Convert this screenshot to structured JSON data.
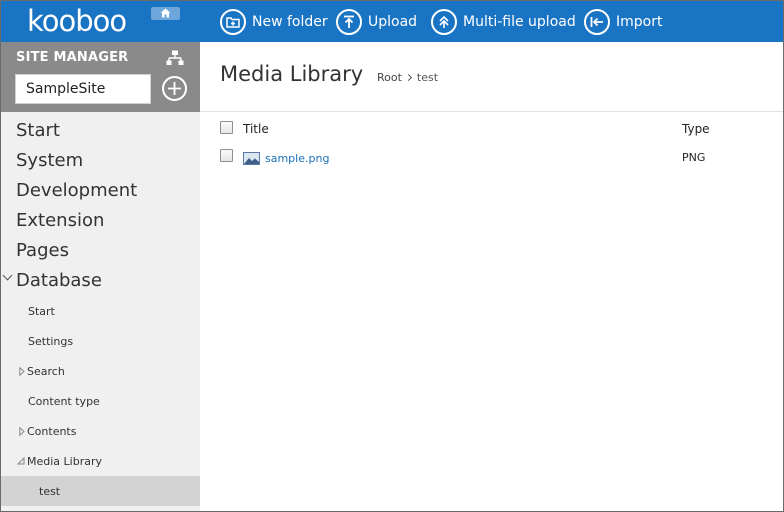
{
  "app": {
    "logo_text": "kooboo"
  },
  "toolbar": {
    "buttons": [
      {
        "label": "New folder",
        "icon": "new-folder-icon"
      },
      {
        "label": "Upload",
        "icon": "upload-icon"
      },
      {
        "label": "Multi-file upload",
        "icon": "multi-upload-icon"
      },
      {
        "label": "Import",
        "icon": "import-icon"
      }
    ]
  },
  "sidebar": {
    "title": "SITE MANAGER",
    "site_name": "SampleSite",
    "top_items": [
      "Start",
      "System",
      "Development",
      "Extension",
      "Pages",
      "Database"
    ],
    "sub_items": [
      "Start",
      "Settings",
      "Search",
      "Content type",
      "Contents",
      "Media Library",
      "test"
    ],
    "active_item": "test"
  },
  "main": {
    "title": "Media Library",
    "breadcrumb": [
      "Root",
      "test"
    ],
    "columns": {
      "title": "Title",
      "type": "Type"
    },
    "rows": [
      {
        "name": "sample.png",
        "type": "PNG",
        "icon": "image-file-icon"
      }
    ]
  },
  "colors": {
    "topbar": "#1a74c4",
    "sidebar_header": "#8a8a8a",
    "sidebar_bg": "#f0f0f0",
    "active_row": "#d3d3d3",
    "link": "#1a6fb8"
  }
}
